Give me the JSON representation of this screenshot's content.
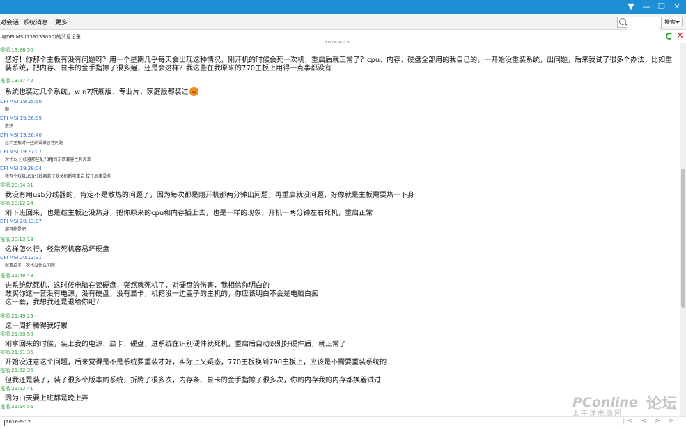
{
  "tabs": [
    "对会话",
    "系统消息",
    "更多"
  ],
  "search": {
    "placeholder": "",
    "button_label": "搜索"
  },
  "history_title": "与DFI MSI(739233050)的消息记录",
  "date_header": "2016-9-12",
  "messages": [
    {
      "sender": "祝福",
      "time": "13:26:50",
      "self": true,
      "size": "big",
      "lines": [
        "您好！你那个主板有没有问题呀？用一个星期几乎每天会出现这种情况，刚开机的时候会死一次机，重启后就正常了？cpu、内存、硬盘全部用的我自己的，一开始没重装系统，出问题，后来我试了很多个办法，比如重",
        "装系统，把内存、显卡的金手指擦了很多遍，还是会这样？我这些在我原来的770主板上用得一点事都没有"
      ]
    },
    {
      "sender": "祝福",
      "time": "13:27:42",
      "self": true,
      "size": "big",
      "lines": [
        "系统也装过几个系统，win7旗舰版、专业片、家庭版都装过"
      ],
      "emoji": true
    },
    {
      "sender": "DFI MSI",
      "time": "19:25:50",
      "self": false,
      "size": "small",
      "lines": [
        "额"
      ]
    },
    {
      "sender": "DFI MSI",
      "time": "19:26:09",
      "self": false,
      "size": "small",
      "lines": [
        "散热............"
      ]
    },
    {
      "sender": "DFI MSI",
      "time": "19:26:40",
      "self": false,
      "size": "small",
      "lines": [
        "这个主板对一些外设兼容性问题"
      ]
    },
    {
      "sender": "DFI MSI",
      "time": "19:27:07",
      "self": false,
      "size": "small",
      "lines": [
        "对什么 分线器那些乱78糟的东西兼容性有点差"
      ]
    },
    {
      "sender": "DFI MSI",
      "time": "19:28:04",
      "self": false,
      "size": "small",
      "lines": [
        "我有个垃圾USB分线器差了就关机断电重启 拔了屁事没有"
      ]
    },
    {
      "sender": "祝福",
      "time": "20:04:31",
      "self": true,
      "size": "big",
      "lines": [
        "我没有用usb分线器的，肯定不是散热的问题了，因为每次都是刚开机那两分钟出问题，再重启就没问题，好像就是主板需要热一下身"
      ]
    },
    {
      "sender": "祝福",
      "time": "20:12:24",
      "self": true,
      "size": "big",
      "lines": [
        "刚下班回来，也是趁主板还没热身，把你原来的cpu和内存插上去，也是一样的现象，开机一两分钟左右死机，重启正常"
      ]
    },
    {
      "sender": "DFI MSI",
      "time": "20:13:07",
      "self": false,
      "size": "small",
      "lines": [
        "那可能是吧"
      ]
    },
    {
      "sender": "祝福",
      "time": "20:13:18",
      "self": true,
      "size": "big",
      "lines": [
        "这样怎么行，经常死机容易坏硬盘"
      ]
    },
    {
      "sender": "DFI MSI",
      "time": "20:13:21",
      "self": false,
      "size": "small",
      "lines": [
        "就重启多一次也没什么问题"
      ]
    },
    {
      "sender": "祝福",
      "time": "21:48:48",
      "self": true,
      "size": "big",
      "lines": [
        "进系统就死机，这时候电脑在读硬盘，突然就死机了，对硬盘的伤害，我相信你明白的",
        "敢买你这一套没有电源，没有硬盘，没有显卡，机箱没一边盖子的主机的，你应该明白不会是电脑白痴",
        "这一套，我想我还是退给你吧？"
      ]
    },
    {
      "sender": "祝福",
      "time": "21:49:29",
      "self": true,
      "size": "big",
      "lines": [
        "这一周折腾得我好累"
      ]
    },
    {
      "sender": "祝福",
      "time": "21:50:58",
      "self": true,
      "size": "big",
      "lines": [
        "刚拿回来的时候，装上我的电源、显卡、硬盘，进系统在识别硬件就死机，重启后自动识别好硬件后，就正常了"
      ]
    },
    {
      "sender": "祝福",
      "time": "21:51:36",
      "self": true,
      "size": "big",
      "lines": [
        "开始没注意这个问题，后来觉得是不是系统要重装才好，实际上又疑惑，770主板换到790主板上，应该是不需要重装系统的"
      ]
    },
    {
      "sender": "祝福",
      "time": "21:52:36",
      "self": true,
      "size": "big",
      "lines": [
        "但我还是装了，装了很多个版本的系统，折腾了很多次，内存条、显卡的金手指擦了很多次，你的内存我的内存都换着试过"
      ]
    },
    {
      "sender": "祝福",
      "time": "21:52:41",
      "self": true,
      "size": "big",
      "lines": [
        "因为白天要上班都是晚上弄"
      ]
    },
    {
      "sender": "祝福",
      "time": "21:54:56",
      "self": true,
      "size": "big",
      "lines": []
    }
  ],
  "footer": {
    "date": "2016-9-12",
    "pager": "|< < > >|"
  },
  "watermark": {
    "brand": "PConline",
    "sub": "太平洋电脑网",
    "forum": "论坛"
  },
  "colors": {
    "titlebar": "#1e8fd6",
    "self_sender": "#2e9f3e",
    "other_sender": "#2a6fcf"
  },
  "icons": [
    "minimize-icon",
    "maximize-icon",
    "close-window-icon",
    "search-icon",
    "refresh-icon",
    "close-icon",
    "smile-emoji-icon"
  ]
}
